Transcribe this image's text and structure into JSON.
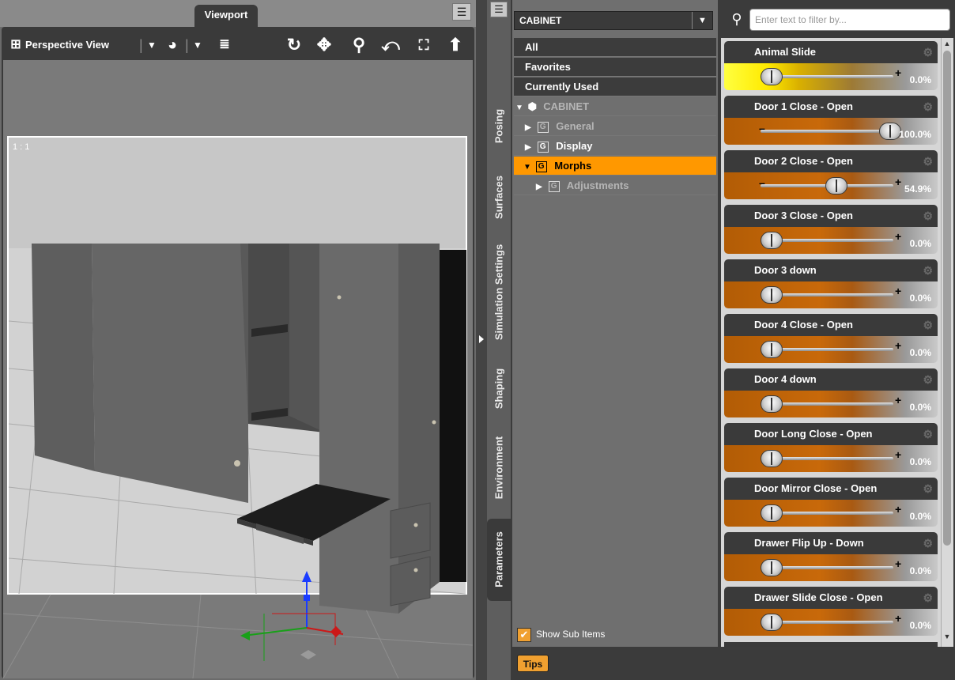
{
  "viewport": {
    "tab_label": "Viewport",
    "camera_label": "Perspective View",
    "frame_ratio": "1 : 1",
    "icons": [
      "grid-icon",
      "dropdown-arrow-icon",
      "shading-sphere-icon",
      "pane-options-icon",
      "orbit-icon",
      "pan-icon",
      "zoom-icon",
      "rotate-icon",
      "frame-icon",
      "home-icon"
    ]
  },
  "tabs": {
    "posing": "Posing",
    "surfaces": "Surfaces",
    "simulation": "Simulation Settings",
    "shaping": "Shaping",
    "environment": "Environment",
    "parameters": "Parameters"
  },
  "tree": {
    "node_select": "CABINET",
    "items": [
      {
        "label": "All"
      },
      {
        "label": "Favorites"
      },
      {
        "label": "Currently Used"
      },
      {
        "label": "CABINET"
      },
      {
        "label": "General"
      },
      {
        "label": "Display"
      },
      {
        "label": "Morphs"
      },
      {
        "label": "Adjustments"
      }
    ],
    "show_sub_items": "Show Sub Items",
    "show_sub_items_checked": true
  },
  "filter": {
    "placeholder": "Enter text to filter by..."
  },
  "sliders": [
    {
      "label": "Animal Slide",
      "value_text": "0.0%",
      "value": 0.0,
      "style": "yellow"
    },
    {
      "label": "Door 1 Close - Open",
      "value_text": "100.0%",
      "value": 1.0,
      "style": "orange"
    },
    {
      "label": "Door 2 Close - Open",
      "value_text": "54.9%",
      "value": 0.549,
      "style": "orange"
    },
    {
      "label": "Door 3 Close - Open",
      "value_text": "0.0%",
      "value": 0.0,
      "style": "orange"
    },
    {
      "label": "Door 3 down",
      "value_text": "0.0%",
      "value": 0.0,
      "style": "orange"
    },
    {
      "label": "Door 4 Close - Open",
      "value_text": "0.0%",
      "value": 0.0,
      "style": "orange"
    },
    {
      "label": "Door 4 down",
      "value_text": "0.0%",
      "value": 0.0,
      "style": "orange"
    },
    {
      "label": "Door Long Close - Open",
      "value_text": "0.0%",
      "value": 0.0,
      "style": "orange"
    },
    {
      "label": "Door Mirror Close - Open",
      "value_text": "0.0%",
      "value": 0.0,
      "style": "orange"
    },
    {
      "label": "Drawer Flip Up - Down",
      "value_text": "0.0%",
      "value": 0.0,
      "style": "orange"
    },
    {
      "label": "Drawer Slide Close - Open",
      "value_text": "0.0%",
      "value": 0.0,
      "style": "orange"
    }
  ],
  "bottom": {
    "tips_label": "Tips"
  },
  "colors": {
    "accent": "#ff9800",
    "panel_dark": "#3a3a3a"
  }
}
